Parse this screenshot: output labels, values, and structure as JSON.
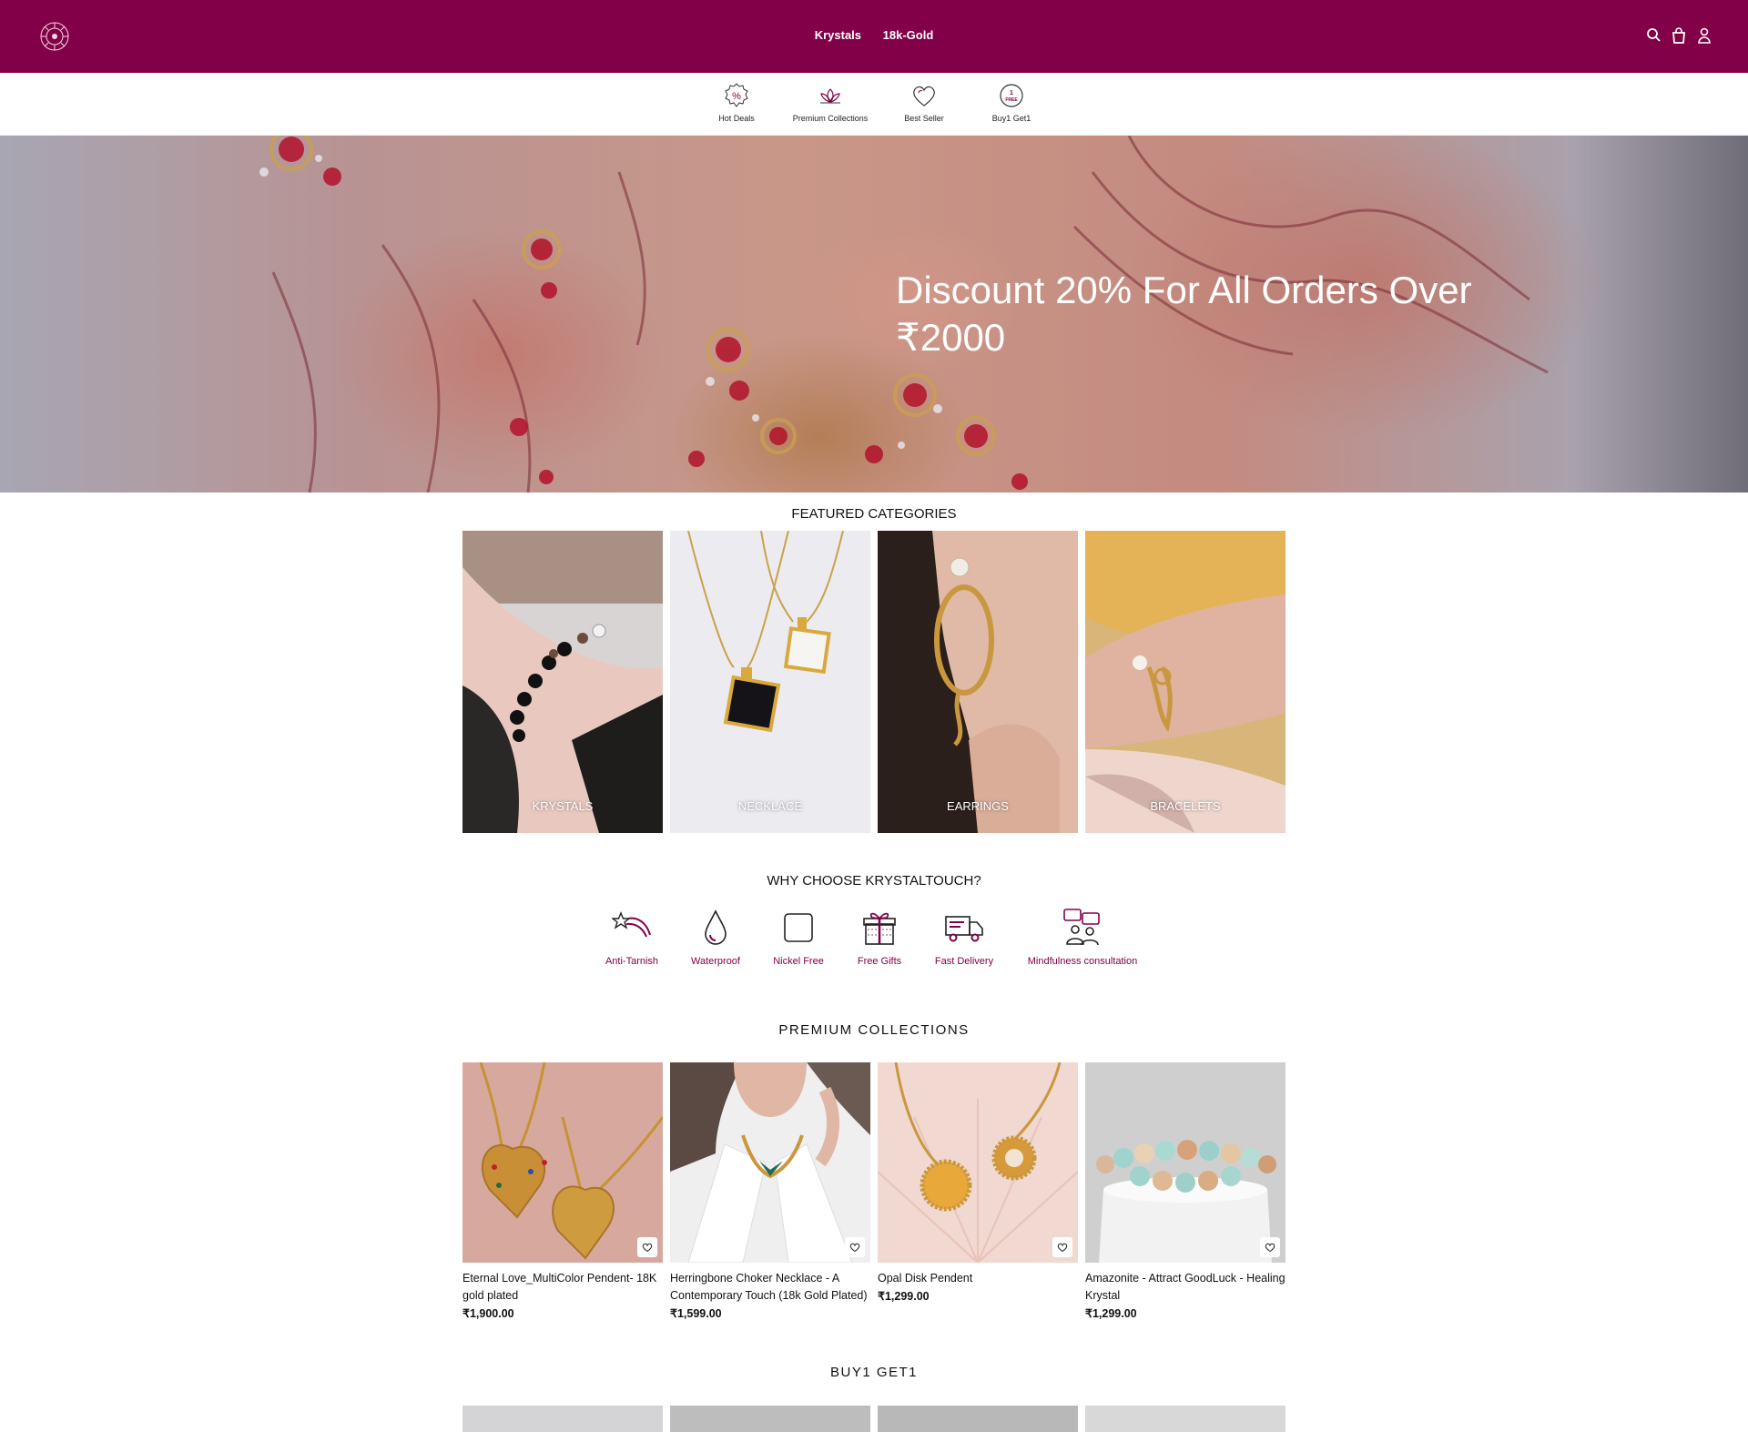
{
  "header": {
    "nav": [
      "Krystals",
      "18k-Gold"
    ],
    "icons": [
      "search-icon",
      "shopping-bag-icon",
      "user-icon"
    ]
  },
  "quick_links": [
    {
      "label": "Hot Deals",
      "icon": "percent-badge-icon"
    },
    {
      "label": "Premium Collections",
      "icon": "lotus-icon"
    },
    {
      "label": "Best Seller",
      "icon": "heart-icon"
    },
    {
      "label": "Buy1 Get1",
      "icon": "one-free-badge-icon",
      "badge_top": "1",
      "badge_bottom": "FREE"
    }
  ],
  "hero": {
    "headline": "Discount 20% For All Orders Over ₹2000"
  },
  "featured": {
    "title": "FEATURED CATEGORIES",
    "categories": [
      "KRYSTALS",
      "NECKLACE",
      "EARRINGS",
      "BRACELETS"
    ]
  },
  "why": {
    "title": "WHY CHOOSE KRYSTALTOUCH?",
    "items": [
      {
        "label": "Anti-Tarnish",
        "icon": "shooting-star-icon"
      },
      {
        "label": "Waterproof",
        "icon": "water-drop-icon"
      },
      {
        "label": "Nickel Free",
        "icon": "square-outline-icon"
      },
      {
        "label": "Free Gifts",
        "icon": "gift-box-icon"
      },
      {
        "label": "Fast Delivery",
        "icon": "delivery-truck-icon"
      },
      {
        "label": "Mindfulness consultation",
        "icon": "consultation-icon"
      }
    ]
  },
  "premium": {
    "title": "PREMIUM COLLECTIONS",
    "products": [
      {
        "name": "Eternal Love_MultiColor Pendent- 18K gold plated",
        "price": "₹1,900.00"
      },
      {
        "name": "Herringbone Choker Necklace - A Contemporary Touch (18k Gold Plated)",
        "price": "₹1,599.00"
      },
      {
        "name": "Opal Disk Pendent",
        "price": "₹1,299.00"
      },
      {
        "name": "Amazonite - Attract GoodLuck - Healing Krystal",
        "price": "₹1,299.00"
      }
    ]
  },
  "buy1get1": {
    "title": "BUY1 GET1"
  },
  "colors": {
    "brand": "#820047",
    "text": "#111111"
  }
}
